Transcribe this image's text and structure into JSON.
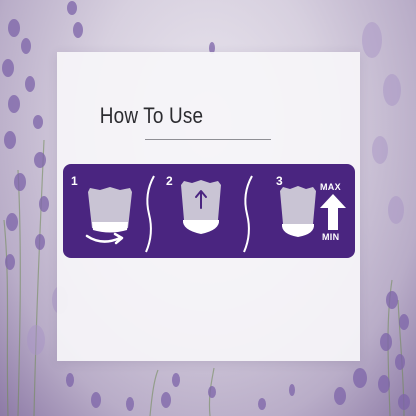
{
  "panel": {
    "title": "How To Use"
  },
  "steps": [
    {
      "number": "1",
      "icon": "cup-with-twist-arrow-icon"
    },
    {
      "number": "2",
      "icon": "cup-with-up-arrow-icon"
    },
    {
      "number": "3",
      "icon": "cup-with-level-arrow-icon"
    }
  ],
  "level_scale": {
    "max_label": "MAX",
    "min_label": "MIN"
  },
  "colors": {
    "bar": "#4a2580",
    "cup": "#c9c4d4",
    "cup_band": "#ffffff",
    "text": "#2c2c30"
  }
}
